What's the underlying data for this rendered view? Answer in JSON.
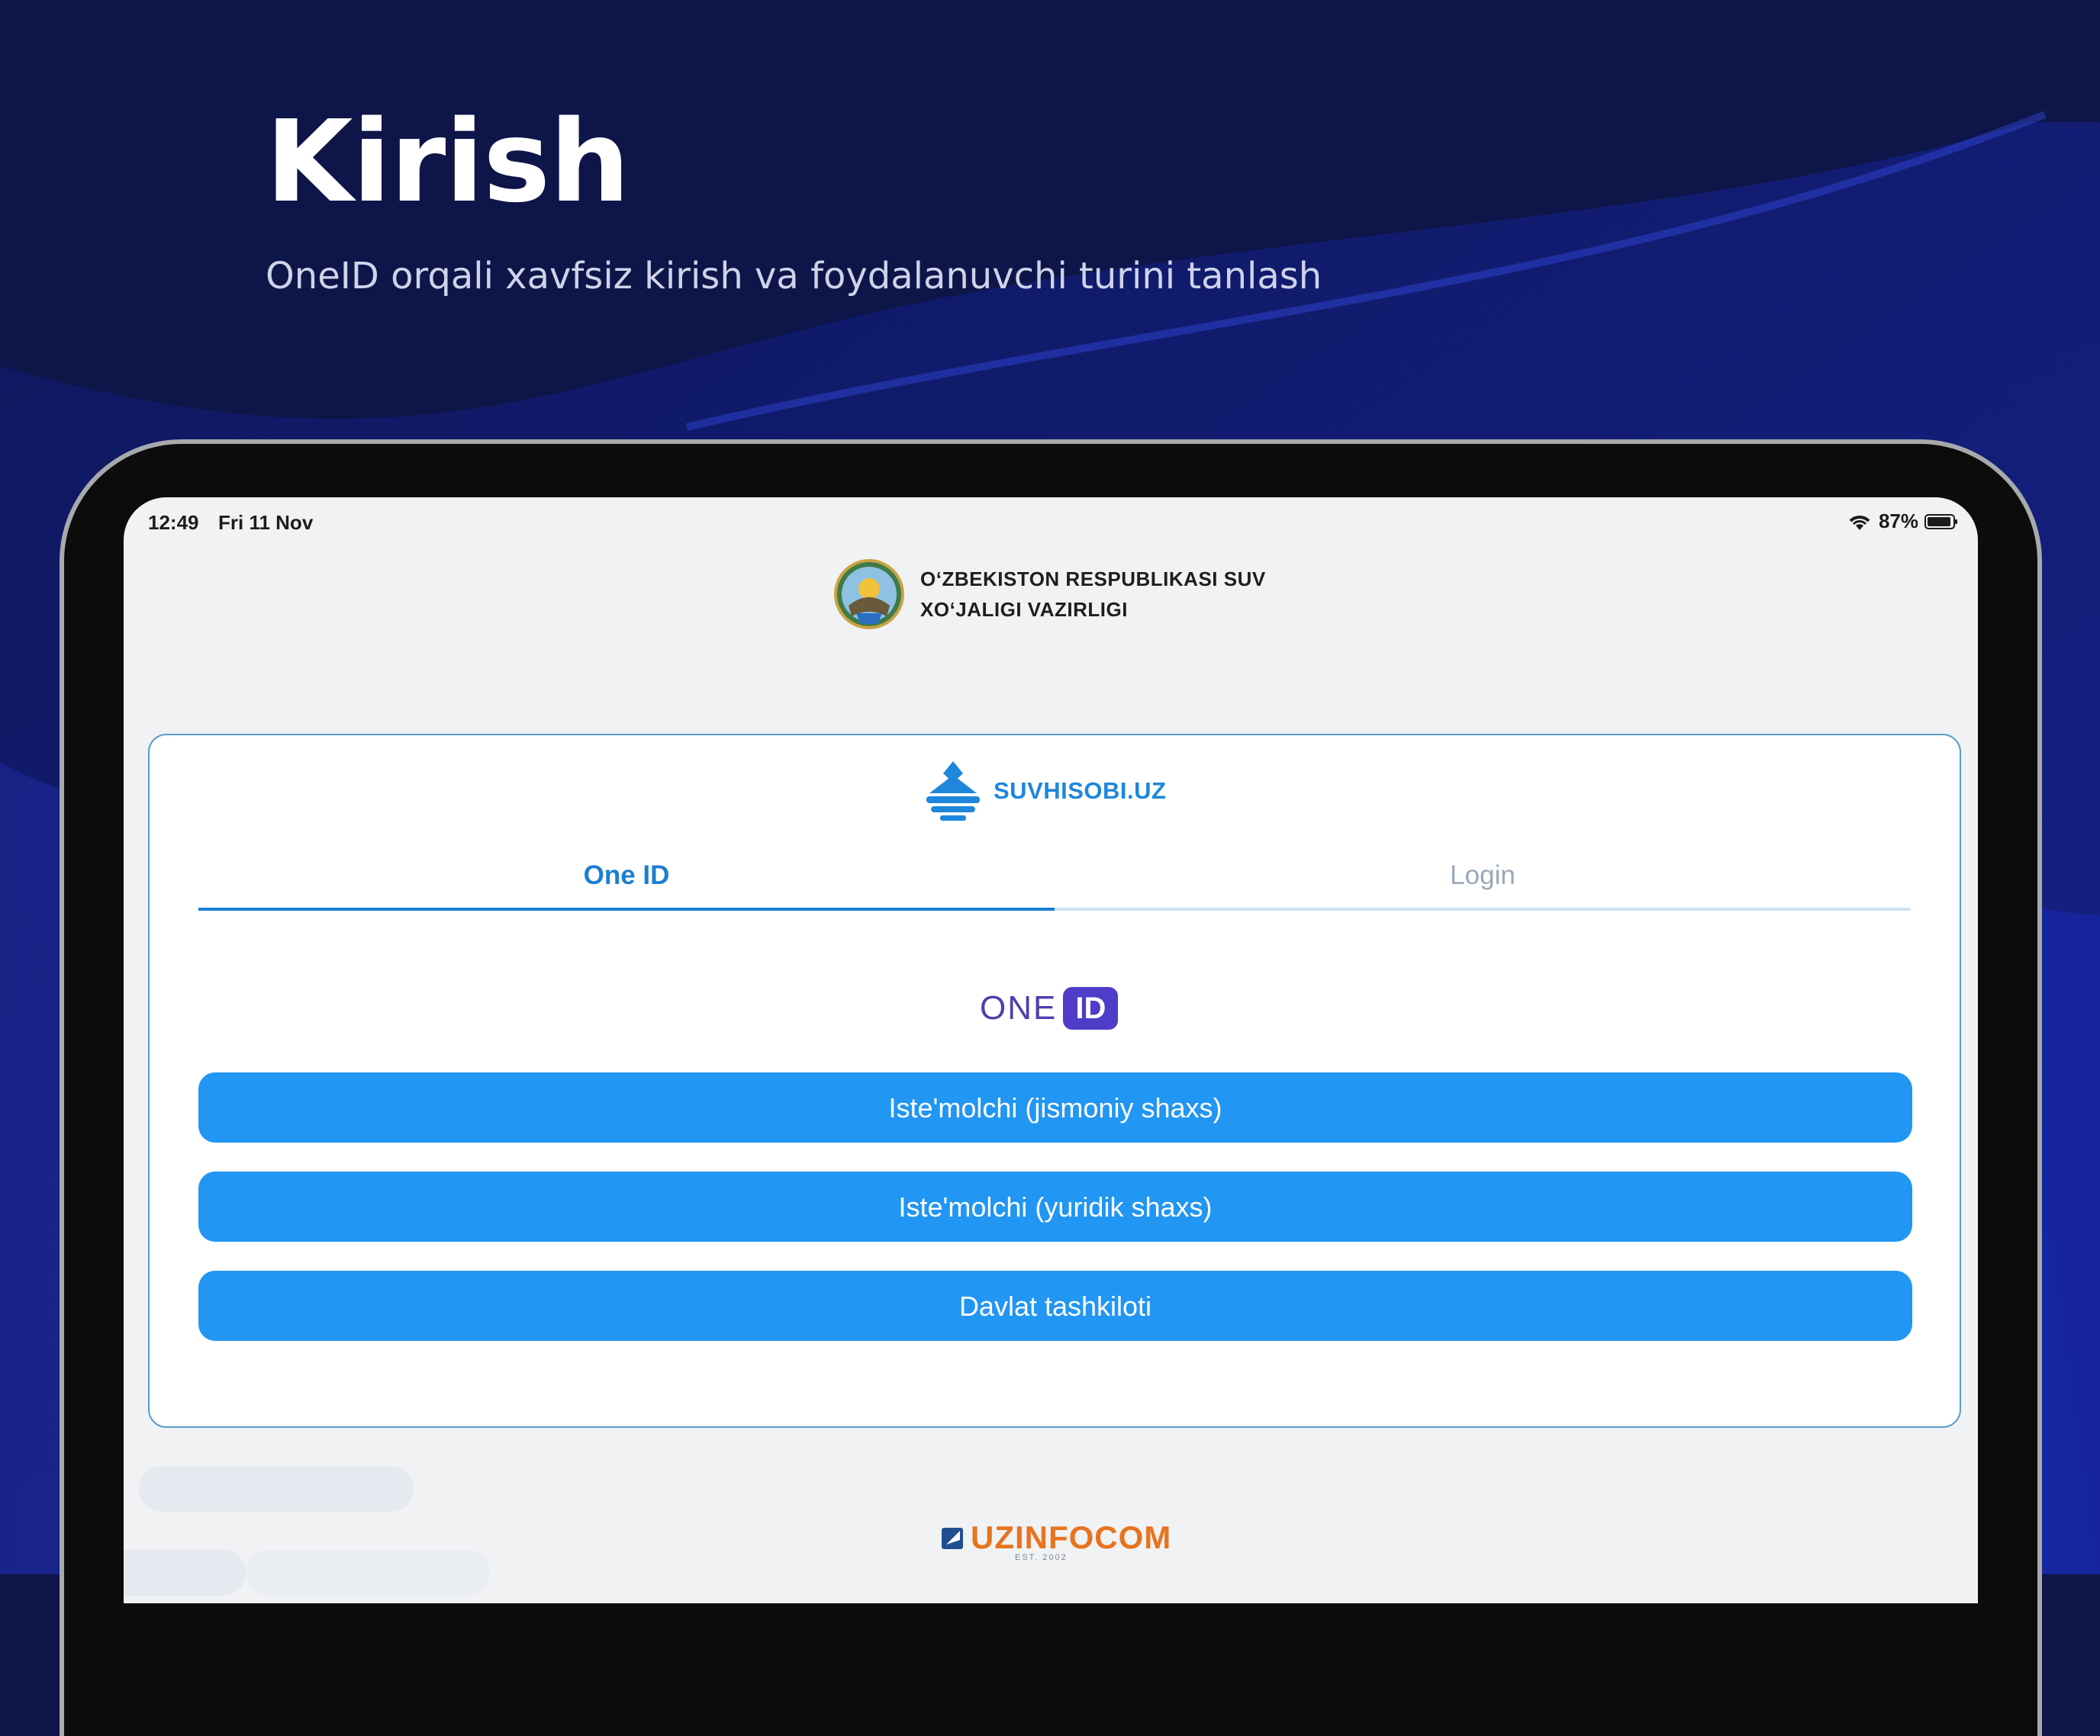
{
  "hero": {
    "title": "Kirish",
    "subtitle": "OneID orqali xavfsiz kirish va foydalanuvchi turini tanlash"
  },
  "status_bar": {
    "time": "12:49",
    "date": "Fri 11 Nov",
    "battery": "87%",
    "icons": [
      "wifi-icon",
      "battery-icon"
    ]
  },
  "ministry": {
    "line1": "O‘ZBEKISTON RESPUBLIKASI SUV",
    "line2": "XO‘JALIGI VAZIRLIGI",
    "icon": "state-emblem-icon"
  },
  "brand": {
    "name": "SUVHISOBI.UZ",
    "icon": "water-drop-logo-icon"
  },
  "tabs": [
    {
      "label": "One ID",
      "active": true
    },
    {
      "label": "Login",
      "active": false
    }
  ],
  "oneid_logo": {
    "word": "ONE",
    "badge": "ID"
  },
  "buttons": [
    {
      "label": "Iste'molchi (jismoniy shaxs)"
    },
    {
      "label": "Iste'molchi (yuridik shaxs)"
    },
    {
      "label": "Davlat tashkiloti"
    }
  ],
  "footer": {
    "name": "UZINFOCOM",
    "est": "EST. 2002",
    "icon": "uzinfocom-icon"
  },
  "colors": {
    "background": "#0e1548",
    "accent": "#2196f3",
    "tab_active": "#1b7fd0",
    "oneid": "#4f3cc9",
    "footer_brand": "#e8731f"
  }
}
